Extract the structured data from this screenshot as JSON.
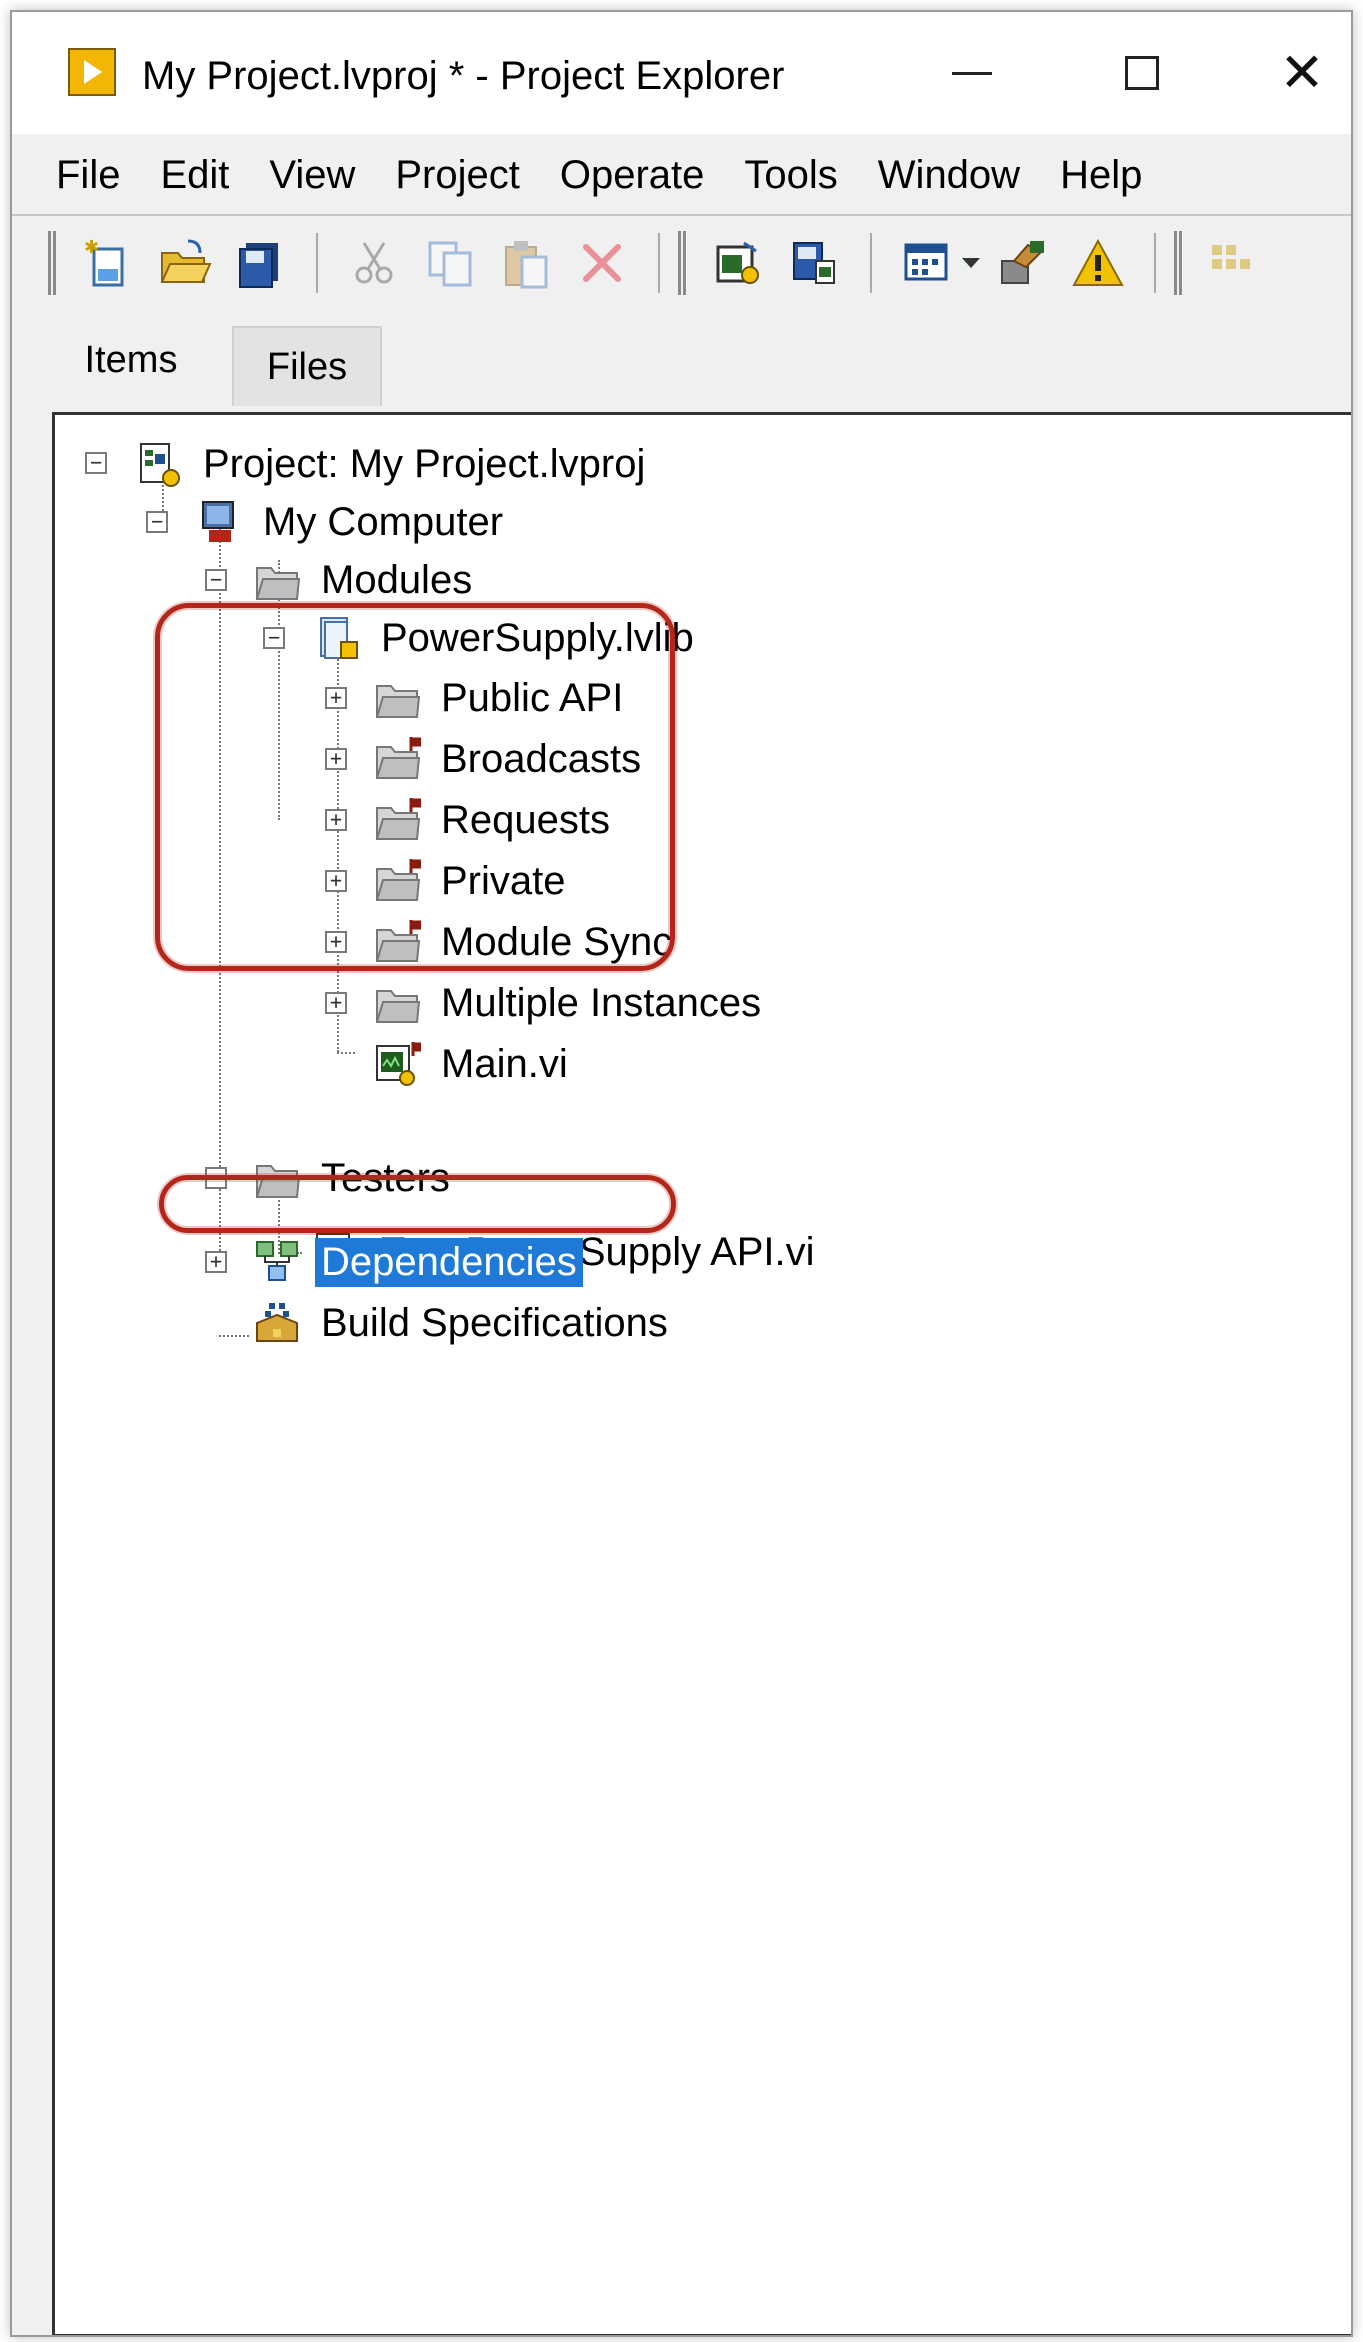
{
  "window": {
    "title": "My Project.lvproj * - Project Explorer"
  },
  "menu": [
    "File",
    "Edit",
    "View",
    "Project",
    "Operate",
    "Tools",
    "Window",
    "Help"
  ],
  "toolbar": {
    "buttons": [
      "new-icon",
      "open-icon",
      "save-all-icon",
      "cut-icon",
      "copy-icon",
      "paste-icon",
      "delete-icon",
      "vi-properties-icon",
      "save-icon",
      "view-options-icon",
      "deploy-icon",
      "warning-icon",
      "build-icon"
    ]
  },
  "tabs": {
    "items": "Items",
    "files": "Files"
  },
  "tree": {
    "project": "Project: My Project.lvproj",
    "computer": "My Computer",
    "modules": "Modules",
    "library": "PowerSupply.lvlib",
    "lib_children": [
      "Public API",
      "Broadcasts",
      "Requests",
      "Private",
      "Module Sync",
      "Multiple Instances",
      "Main.vi"
    ],
    "testers": "Testers",
    "test_vi": "Test PowerSupply API.vi",
    "dependencies": "Dependencies",
    "build_specs": "Build Specifications"
  },
  "colors": {
    "highlight": "#b5261a",
    "selection": "#1e7ad6",
    "folder": "#c9c9c9",
    "scope_flag": "#8b1a10"
  }
}
